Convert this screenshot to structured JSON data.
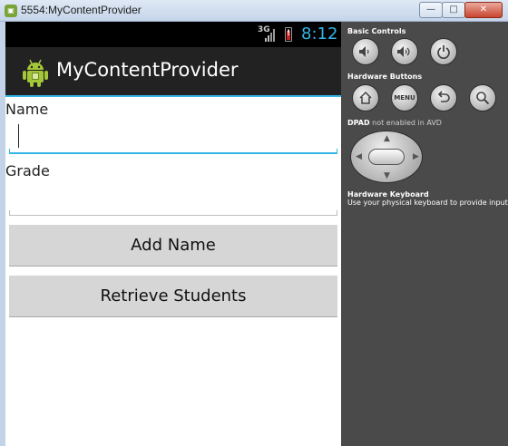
{
  "window": {
    "icon": "android-emulator-icon",
    "title": "5554:MyContentProvider",
    "buttons": {
      "minimize": "—",
      "maximize": "□",
      "close": "✕"
    }
  },
  "statusbar": {
    "network": "3G",
    "battery_alert": "!",
    "time": "8:12"
  },
  "actionbar": {
    "icon": "android-robot-icon",
    "title": "MyContentProvider"
  },
  "form": {
    "name_label": "Name",
    "name_value": "",
    "grade_label": "Grade",
    "grade_value": "",
    "add_button": "Add Name",
    "retrieve_button": "Retrieve Students"
  },
  "panel": {
    "basic_controls": "Basic Controls",
    "hardware_buttons": "Hardware Buttons",
    "menu_label": "MENU",
    "dpad_note_bold": "DPAD",
    "dpad_note": "not enabled in AVD",
    "keyboard_head": "Hardware Keyboard",
    "keyboard_note": "Use your physical keyboard to provide input"
  },
  "colors": {
    "accent": "#33b5e5",
    "actionbar": "#222222",
    "statusbar": "#000000",
    "button": "#d6d6d6",
    "panel": "#4a4a4a",
    "battery_low": "#d02020"
  }
}
